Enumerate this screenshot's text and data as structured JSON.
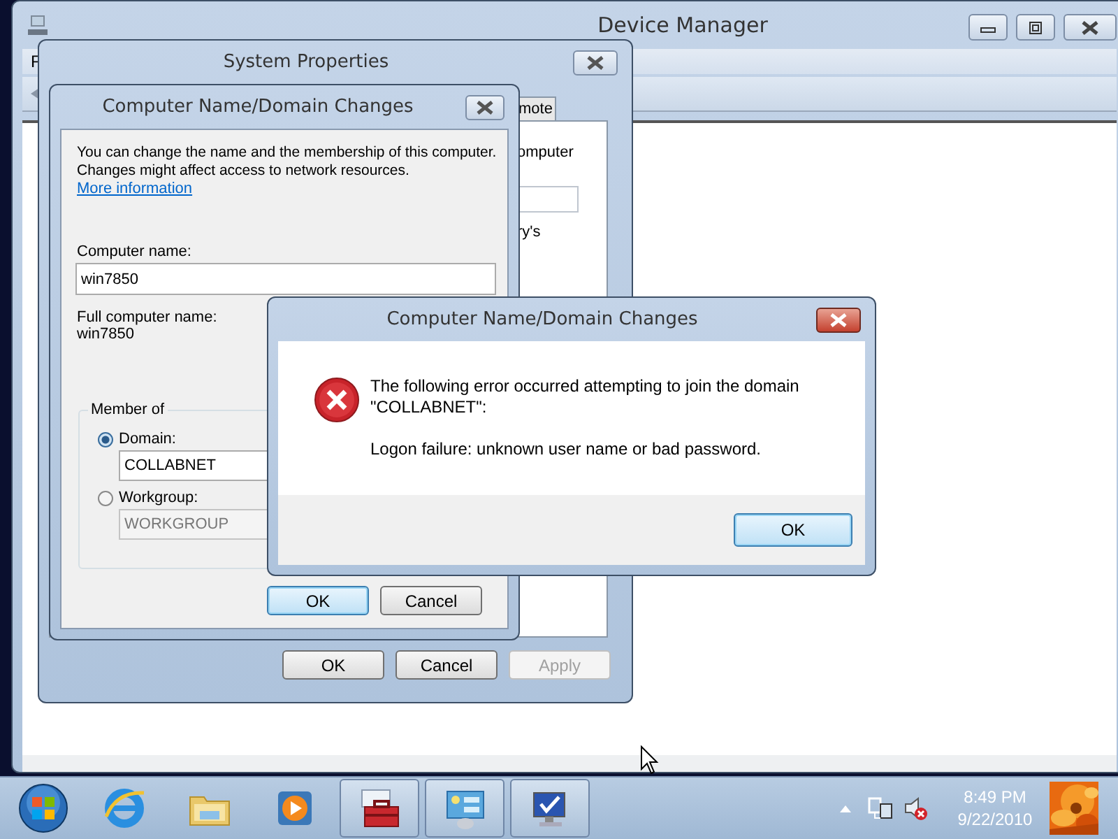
{
  "device_manager": {
    "title": "Device Manager",
    "menu": [
      "F"
    ]
  },
  "system_properties": {
    "title": "System Properties",
    "tabs": [
      {
        "label": "mote",
        "selected": false
      }
    ],
    "page_texts": [
      "omputer",
      "ry's"
    ],
    "buttons": [
      {
        "label": "OK",
        "disabled": false
      },
      {
        "label": "Cancel",
        "disabled": false
      },
      {
        "label": "Apply",
        "disabled": true
      }
    ]
  },
  "name_dialog": {
    "title": "Computer Name/Domain Changes",
    "intro": "You can change the name and the membership of this computer. Changes might affect access to network resources.",
    "link": "More information",
    "computer_name_label": "Computer name:",
    "computer_name": "win7850",
    "full_name_label": "Full computer name:",
    "full_name": "win7850",
    "member_of": {
      "title": "Member of",
      "options": [
        {
          "label": "Domain:",
          "selected": true,
          "value": "COLLABNET",
          "disabled": false
        },
        {
          "label": "Workgroup:",
          "selected": false,
          "value": "WORKGROUP",
          "disabled": true
        }
      ]
    },
    "buttons": [
      {
        "label": "OK",
        "focused": true
      },
      {
        "label": "Cancel",
        "focused": false
      }
    ]
  },
  "error_dialog": {
    "title": "Computer Name/Domain Changes",
    "message": "The following error occurred attempting to join the domain \"COLLABNET\":",
    "detail": "Logon failure: unknown user name or bad password.",
    "button": "OK"
  },
  "taskbar": {
    "items": [
      {
        "kind": "browser",
        "running": false
      },
      {
        "kind": "folder",
        "running": false
      },
      {
        "kind": "media",
        "running": false
      },
      {
        "kind": "toolbox",
        "running": true
      },
      {
        "kind": "panel",
        "running": true
      },
      {
        "kind": "monitor",
        "running": true
      }
    ],
    "clock": {
      "time": "8:49 PM",
      "date": "9/22/2010"
    }
  }
}
